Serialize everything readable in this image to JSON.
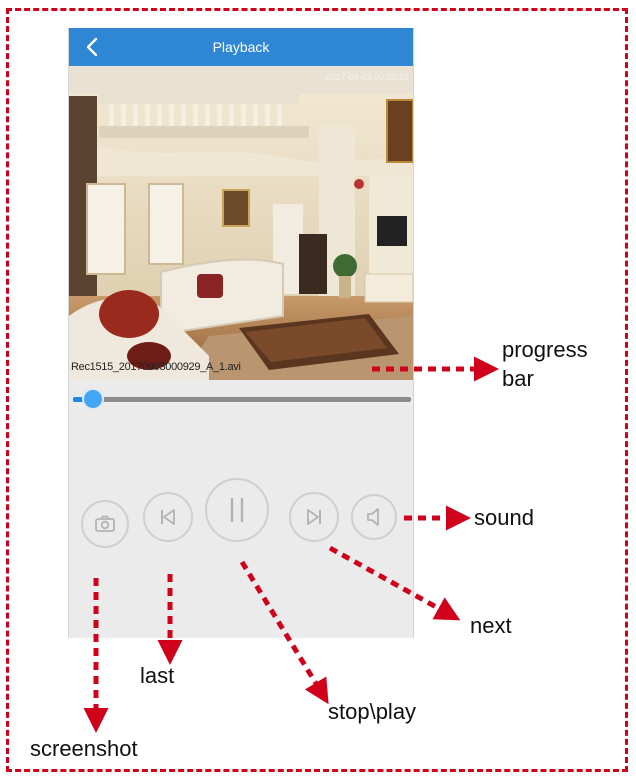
{
  "header": {
    "title": "Playback"
  },
  "video": {
    "timestamp": "2017-09-03 00:09:29"
  },
  "file": {
    "name": "Rec1515_20170903000929_A_1.avi"
  },
  "progress": {
    "value": 0.06
  },
  "controls": [
    {
      "id": "screenshot",
      "icon": "camera-icon"
    },
    {
      "id": "last",
      "icon": "skip-back-icon"
    },
    {
      "id": "play-pause",
      "icon": "pause-icon"
    },
    {
      "id": "next",
      "icon": "skip-forward-icon"
    },
    {
      "id": "sound",
      "icon": "speaker-icon"
    }
  ],
  "annotations": {
    "progress_bar": "progress\nbar",
    "sound": "sound",
    "next": "next",
    "stop_play": "stop\\play",
    "last": "last",
    "screenshot": "screenshot"
  },
  "colors": {
    "header": "#2f86d4",
    "accent": "#42a5f5",
    "annotation": "#d0021b"
  }
}
